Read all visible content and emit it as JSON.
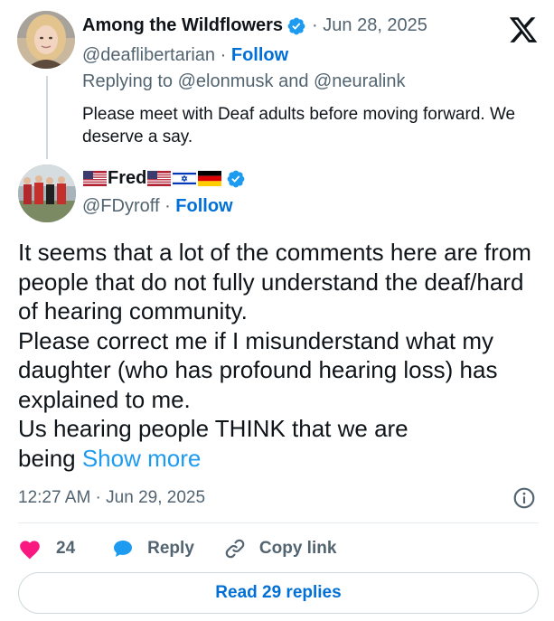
{
  "reply_tweet": {
    "display_name": "Among the Wildflowers",
    "date": "· Jun 28, 2025",
    "handle": "@deaflibertarian",
    "separator": "·",
    "follow_label": "Follow",
    "replying_to": "Replying to @elonmusk and @neuralink",
    "body": "Please meet with Deaf adults before moving forward. We deserve a say."
  },
  "main_tweet": {
    "display_name": "Fred",
    "flags": [
      "us-flag",
      "us-flag",
      "israel-flag",
      "germany-flag"
    ],
    "handle": "@FDyroff",
    "separator": "·",
    "follow_label": "Follow",
    "body_lines": [
      "It seems that a lot of the comments here are from people that do not fully understand the deaf/hard of hearing community.",
      "Please correct me if I misunderstand what my daughter (who has profound hearing loss) has explained to me.",
      "Us hearing people THINK that we are being"
    ],
    "show_more_label": "Show more",
    "timestamp": "12:27 AM · Jun 29, 2025"
  },
  "actions": {
    "like_count": "24",
    "reply_label": "Reply",
    "copy_link_label": "Copy link"
  },
  "read_replies_label": "Read 29 replies",
  "colors": {
    "accent": "#1d9bf0",
    "follow": "#006fd6",
    "like": "#f91880",
    "muted": "#536471",
    "text": "#0f1419"
  }
}
